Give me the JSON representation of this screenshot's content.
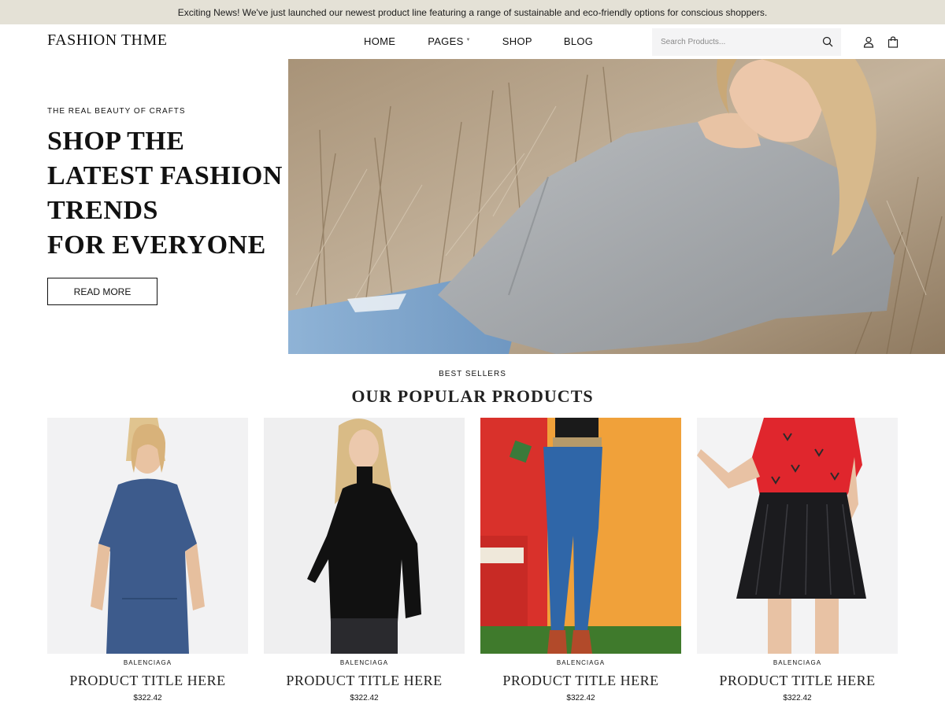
{
  "announcement": "Exciting News! We've just launched our newest product line featuring a range of sustainable and eco-friendly options for conscious shoppers.",
  "header": {
    "logo": "FASHION THME",
    "nav": [
      "HOME",
      "PAGES",
      "SHOP",
      "BLOG"
    ],
    "search_placeholder": "Search Products...",
    "icons": [
      "search-icon",
      "user-icon",
      "shopping-bag-icon"
    ]
  },
  "hero": {
    "kicker": "THE REAL BEAUTY OF CRAFTS",
    "title_lines": [
      "SHOP THE",
      "LATEST FASHION",
      "TRENDS",
      "FOR EVERYONE"
    ],
    "button": "READ MORE"
  },
  "section": {
    "kicker": "BEST SELLERS",
    "title": "OUR POPULAR PRODUCTS"
  },
  "products": [
    {
      "brand": "BALENCIAGA",
      "title": "PRODUCT TITLE HERE",
      "price": "$322.42"
    },
    {
      "brand": "BALENCIAGA",
      "title": "PRODUCT TITLE HERE",
      "price": "$322.42"
    },
    {
      "brand": "BALENCIAGA",
      "title": "PRODUCT TITLE HERE",
      "price": "$322.42"
    },
    {
      "brand": "BALENCIAGA",
      "title": "PRODUCT TITLE HERE",
      "price": "$322.42"
    }
  ],
  "colors": {
    "announcement_bg": "#e4e1d6",
    "text": "#111111",
    "search_bg": "#f4f4f5"
  }
}
